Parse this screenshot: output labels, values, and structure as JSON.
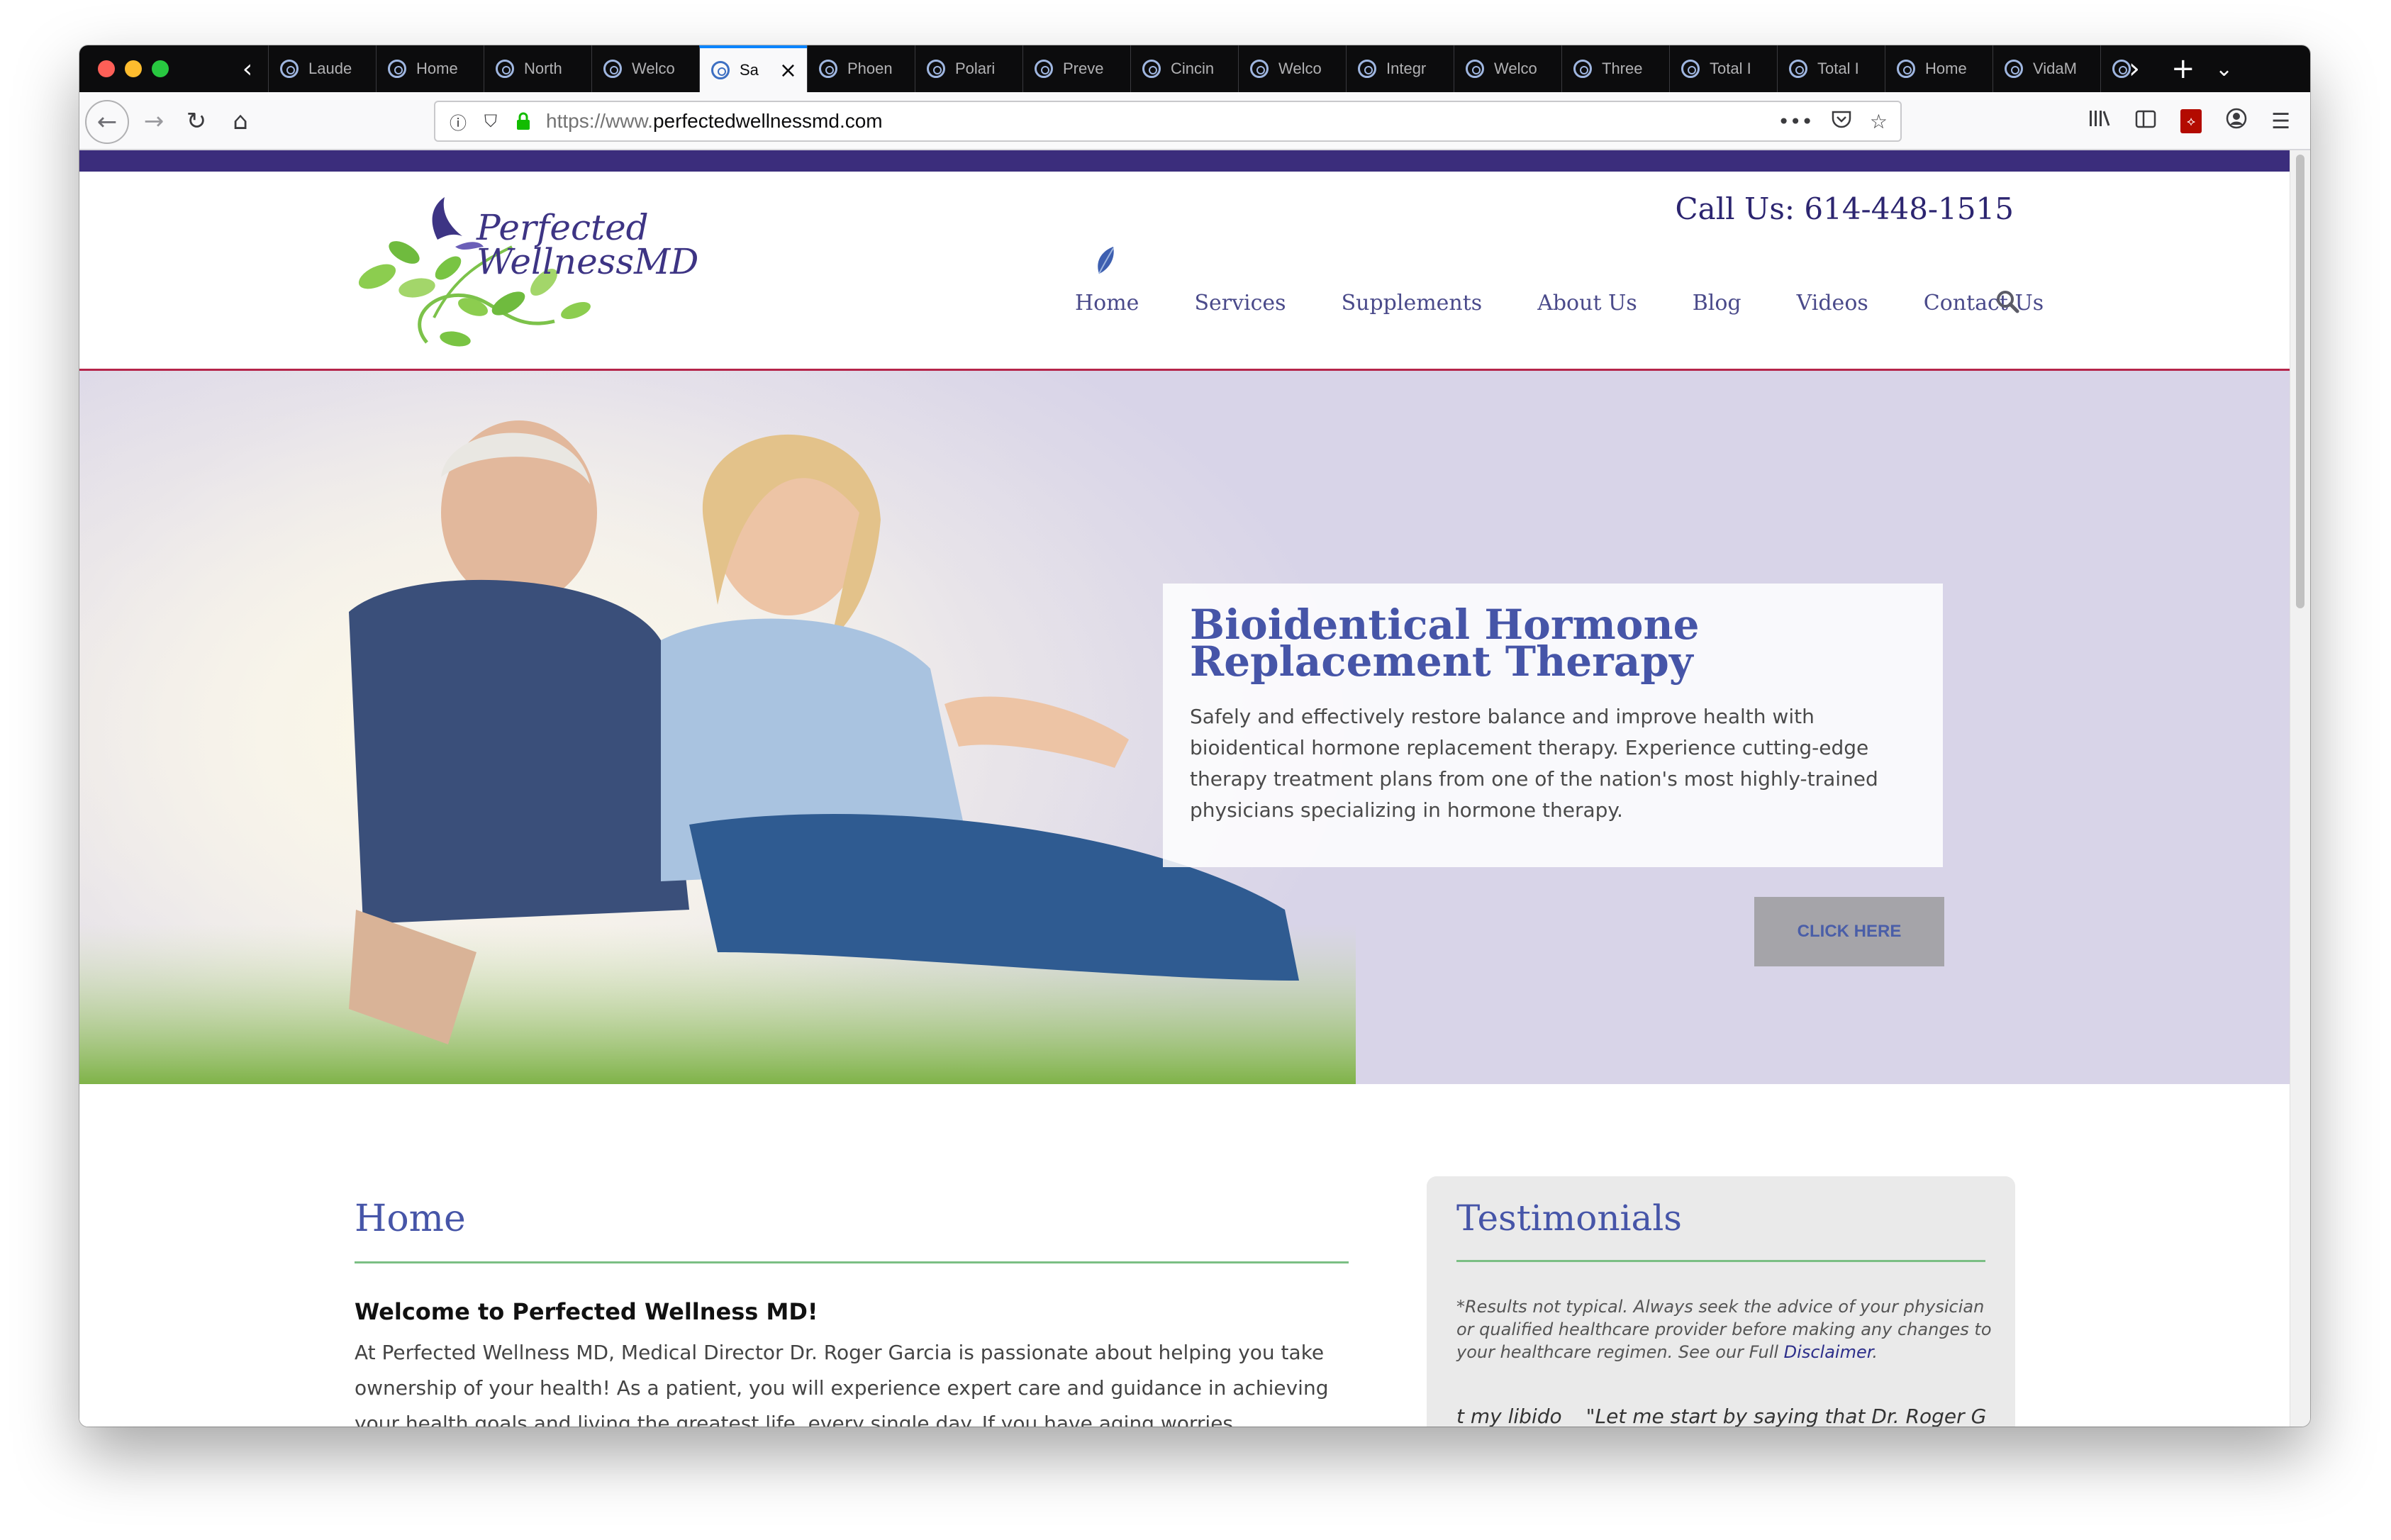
{
  "browser": {
    "tabs": [
      {
        "label": "Laude",
        "active": false
      },
      {
        "label": "Home",
        "active": false
      },
      {
        "label": "North",
        "active": false
      },
      {
        "label": "Welco",
        "active": false
      },
      {
        "label": "Sa",
        "active": true
      },
      {
        "label": "Phoen",
        "active": false
      },
      {
        "label": "Polari",
        "active": false
      },
      {
        "label": "Preve",
        "active": false
      },
      {
        "label": "Cincin",
        "active": false
      },
      {
        "label": "Welco",
        "active": false
      },
      {
        "label": "Integr",
        "active": false
      },
      {
        "label": "Welco",
        "active": false
      },
      {
        "label": "Three",
        "active": false
      },
      {
        "label": "Total I",
        "active": false
      },
      {
        "label": "Total I",
        "active": false
      },
      {
        "label": "Home",
        "active": false
      },
      {
        "label": "VidaM",
        "active": false
      }
    ],
    "url": {
      "scheme": "https://www.",
      "host": "perfectedwellnessmd.com"
    },
    "icons": {
      "back": "arrow-left-icon",
      "forward": "arrow-right-icon",
      "reload": "reload-icon",
      "home": "home-icon",
      "info": "info-icon",
      "shield": "shield-icon",
      "lock": "lock-icon",
      "more": "more-icon",
      "pocket": "pocket-icon",
      "bookmark": "star-icon",
      "library": "library-icon",
      "sidebar": "sidebar-icon",
      "pdf": "pdf-icon",
      "account": "account-icon",
      "menu": "hamburger-icon"
    }
  },
  "site": {
    "logo": {
      "line1": "Perfected",
      "line2": "WellnessMD"
    },
    "phone": "Call Us: 614-448-1515",
    "nav": [
      "Home",
      "Services",
      "Supplements",
      "About Us",
      "Blog",
      "Videos",
      "Contact Us"
    ],
    "colors": {
      "band": "#3b2d7c",
      "accent": "#4655a8",
      "rule": "#7bbf84",
      "headerline": "#b5254a"
    }
  },
  "hero": {
    "title": "Bioidentical Hormone Replacement Therapy",
    "text": "Safely and effectively restore balance and improve health with bioidentical hormone replacement therapy. Experience cutting-edge therapy treatment plans from one of the nation's most highly-trained physicians specializing in hormone therapy.",
    "button": "CLICK HERE"
  },
  "content": {
    "heading": "Home",
    "welcome": "Welcome to Perfected Wellness MD!",
    "intro": "At Perfected Wellness MD, Medical Director Dr. Roger Garcia is passionate about helping you take ownership of your health! As a patient, you will experience expert care and guidance in achieving your health goals and living the greatest life, every single day. If you have aging worries, unpleasant symptoms",
    "testimonials": {
      "heading": "Testimonials",
      "note_prefix": "*Results not typical. Always seek the advice of your physician or qualified healthcare provider before making any changes to your healthcare regimen. See our Full ",
      "note_link": "Disclaimer",
      "note_suffix": ".",
      "quote1": "t my libido",
      "quote2": "\"Let me start by saying that Dr. Roger Garcia"
    }
  }
}
